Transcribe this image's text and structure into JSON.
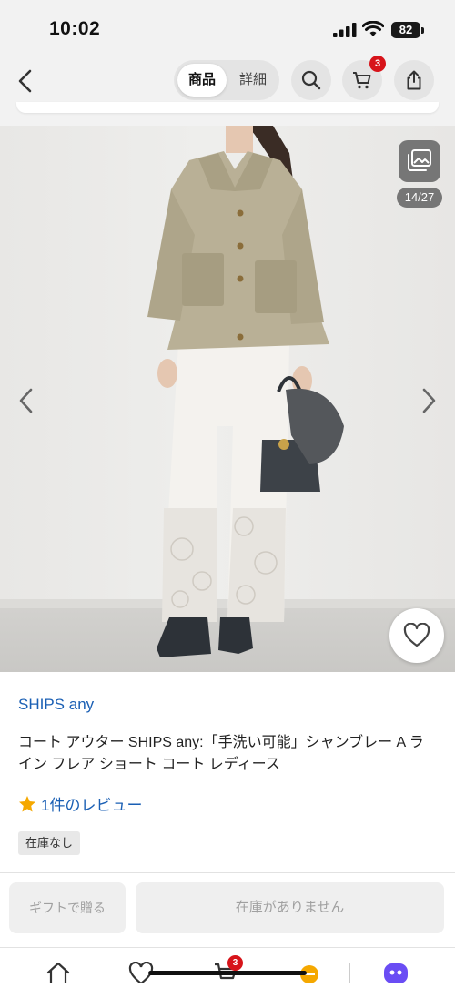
{
  "status_bar": {
    "time": "10:02",
    "battery": "82"
  },
  "header": {
    "tabs": [
      {
        "label": "商品"
      },
      {
        "label": "詳細"
      }
    ],
    "cart_count": "3"
  },
  "gallery": {
    "counter": "14/27"
  },
  "product": {
    "brand": "SHIPS any",
    "title": "コート アウター SHIPS any:「手洗い可能」シャンブレー A ライン フレア ショート コート レディース",
    "review_text": "1件のレビュー",
    "stock_label": "在庫なし"
  },
  "actions": {
    "gift_label": "ギフトで贈る",
    "stock_button_label": "在庫がありません"
  },
  "tab_bar": {
    "cart_count": "3"
  },
  "colors": {
    "link_blue": "#1a5fb4",
    "badge_red": "#d7141a",
    "star_yellow": "#f5a800",
    "disabled_bg": "#efefef"
  }
}
